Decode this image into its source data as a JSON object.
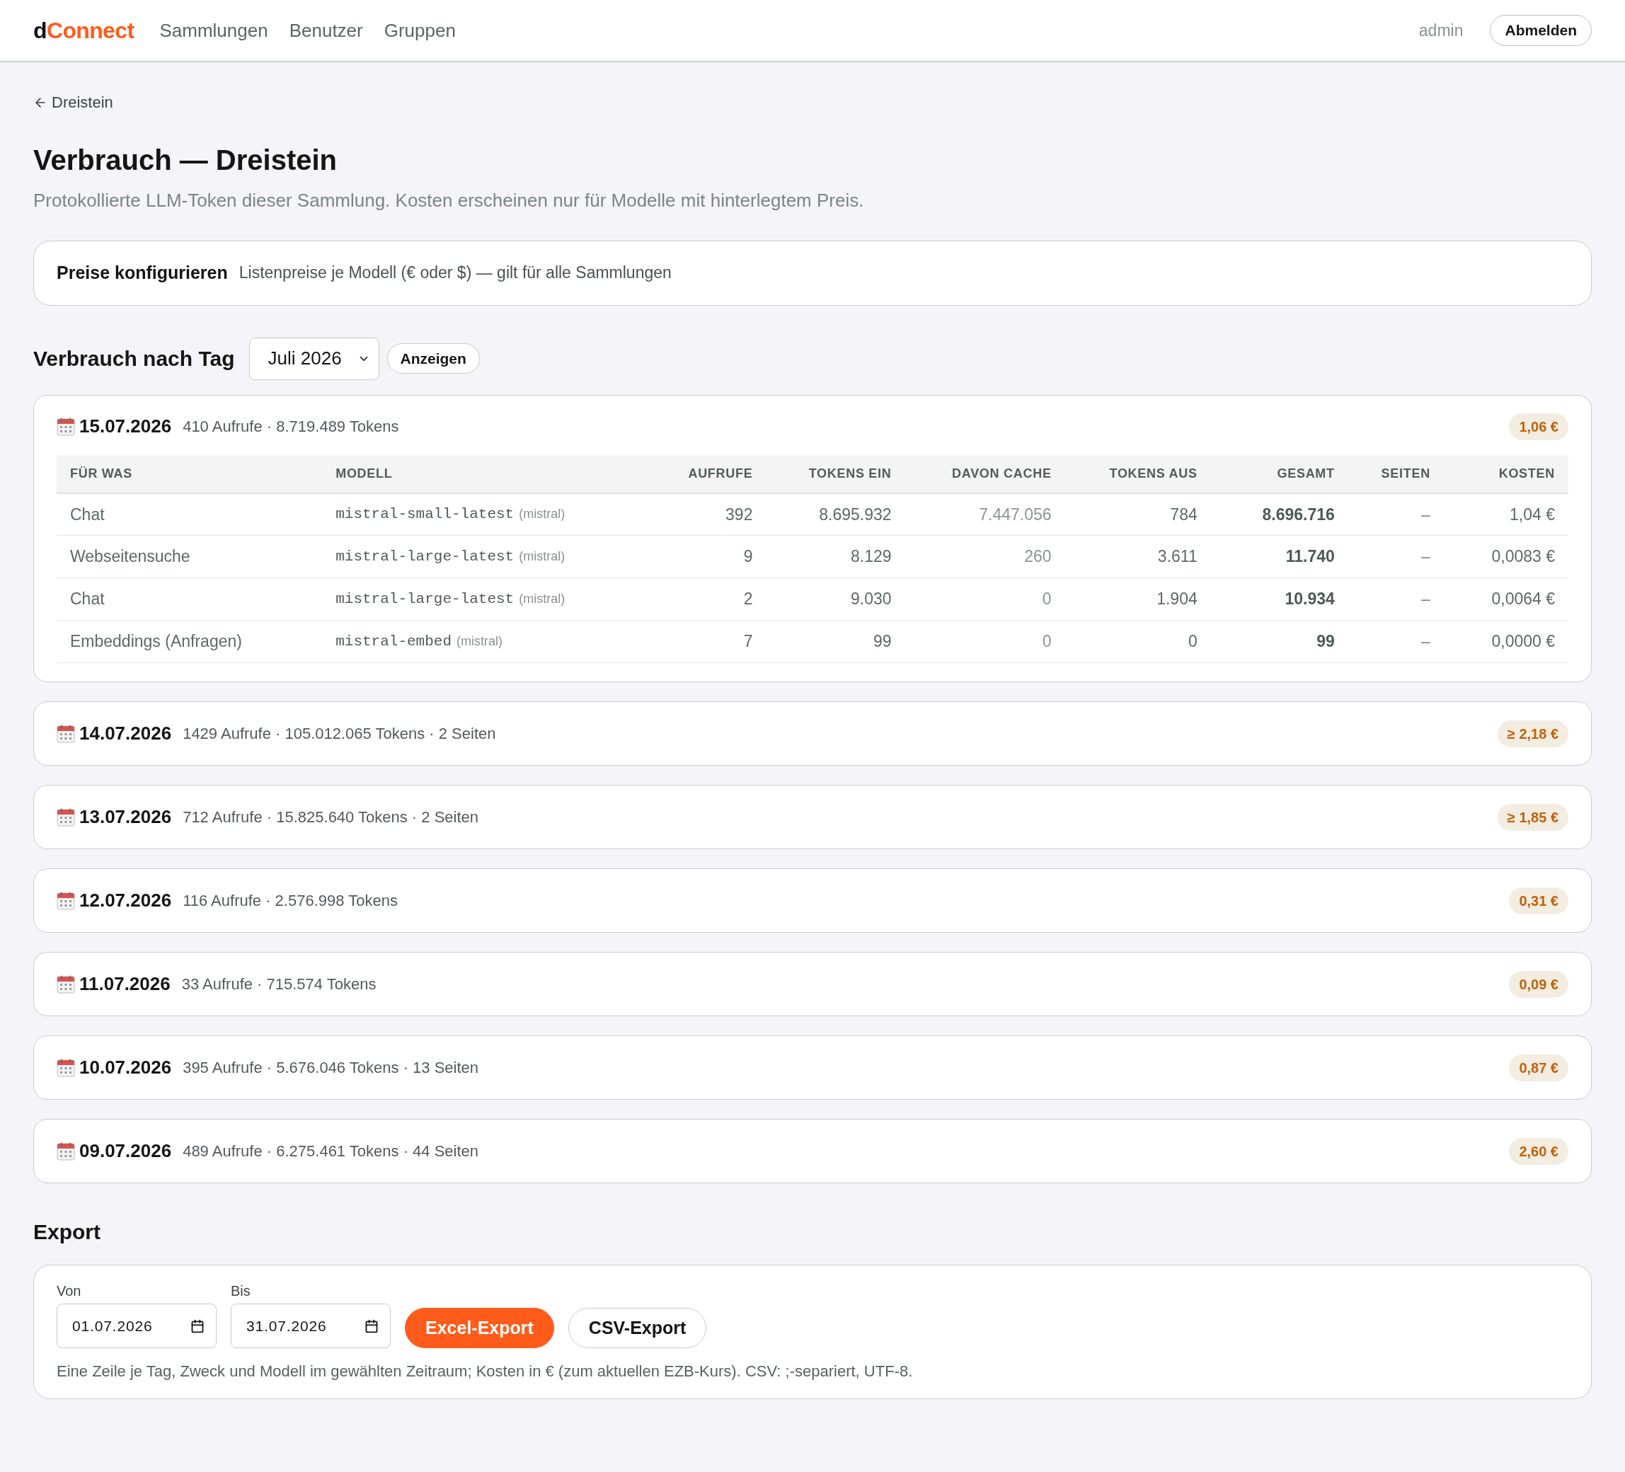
{
  "nav": {
    "logo": {
      "lead": "d",
      "accent": "Connect"
    },
    "links": [
      "Sammlungen",
      "Benutzer",
      "Gruppen"
    ],
    "user": "admin",
    "logout_button": "Abmelden"
  },
  "back_link": "Dreistein",
  "page": {
    "title": "Verbrauch — Dreistein",
    "subtitle": "Protokollierte LLM-Token dieser Sammlung. Kosten erscheinen nur für Modelle mit hinterlegtem Preis."
  },
  "prices_panel": {
    "title": "Preise konfigurieren",
    "description": "Listenpreise je Modell (€ oder $) — gilt für alle Sammlungen"
  },
  "usage": {
    "title": "Verbrauch nach Tag",
    "month_select": {
      "value": "Juli 2026"
    },
    "show_button": "Anzeigen",
    "days": [
      {
        "date": "15.07.2026",
        "summary": "410 Aufrufe · 8.719.489 Tokens",
        "cost": "1,06 €",
        "expanded": true,
        "table": {
          "columns": [
            "FÜR WAS",
            "MODELL",
            "AUFRUFE",
            "TOKENS EIN",
            "DAVON CACHE",
            "TOKENS AUS",
            "GESAMT",
            "SEITEN",
            "KOSTEN"
          ],
          "rows": [
            {
              "purpose": "Chat",
              "model": {
                "name": "mistral-small-latest",
                "provider": "(mistral)"
              },
              "calls": "392",
              "tokens_in": "8.695.932",
              "cached": "7.447.056",
              "tokens_out": "784",
              "total": "8.696.716",
              "pages": "–",
              "cost": "1,04 €"
            },
            {
              "purpose": "Webseitensuche",
              "model": {
                "name": "mistral-large-latest",
                "provider": "(mistral)"
              },
              "calls": "9",
              "tokens_in": "8.129",
              "cached": "260",
              "tokens_out": "3.611",
              "total": "11.740",
              "pages": "–",
              "cost": "0,0083 €"
            },
            {
              "purpose": "Chat",
              "model": {
                "name": "mistral-large-latest",
                "provider": "(mistral)"
              },
              "calls": "2",
              "tokens_in": "9.030",
              "cached": "0",
              "tokens_out": "1.904",
              "total": "10.934",
              "pages": "–",
              "cost": "0,0064 €"
            },
            {
              "purpose": "Embeddings (Anfragen)",
              "model": {
                "name": "mistral-embed",
                "provider": "(mistral)"
              },
              "calls": "7",
              "tokens_in": "99",
              "cached": "0",
              "tokens_out": "0",
              "total": "99",
              "pages": "–",
              "cost": "0,0000 €"
            }
          ]
        }
      },
      {
        "date": "14.07.2026",
        "summary": "1429 Aufrufe · 105.012.065 Tokens · 2 Seiten",
        "cost": "≥ 2,18 €",
        "expanded": false
      },
      {
        "date": "13.07.2026",
        "summary": "712 Aufrufe · 15.825.640 Tokens · 2 Seiten",
        "cost": "≥ 1,85 €",
        "expanded": false
      },
      {
        "date": "12.07.2026",
        "summary": "116 Aufrufe · 2.576.998 Tokens",
        "cost": "0,31 €",
        "expanded": false
      },
      {
        "date": "11.07.2026",
        "summary": "33 Aufrufe · 715.574 Tokens",
        "cost": "0,09 €",
        "expanded": false
      },
      {
        "date": "10.07.2026",
        "summary": "395 Aufrufe · 5.676.046 Tokens · 13 Seiten",
        "cost": "0,87 €",
        "expanded": false
      },
      {
        "date": "09.07.2026",
        "summary": "489 Aufrufe · 6.275.461 Tokens · 44 Seiten",
        "cost": "2,60 €",
        "expanded": false
      }
    ]
  },
  "export": {
    "title": "Export",
    "fields": [
      {
        "label": "Von",
        "value": "01.07.2026"
      },
      {
        "label": "Bis",
        "value": "31.07.2026"
      }
    ],
    "buttons": [
      {
        "label": "Excel-Export",
        "kind": "primary"
      },
      {
        "label": "CSV-Export",
        "kind": "secondary"
      }
    ],
    "note": "Eine Zeile je Tag, Zweck und Modell im gewählten Zeitraum; Kosten in € (zum aktuellen EZB-Kurs). CSV: ;-separiert, UTF-8."
  }
}
